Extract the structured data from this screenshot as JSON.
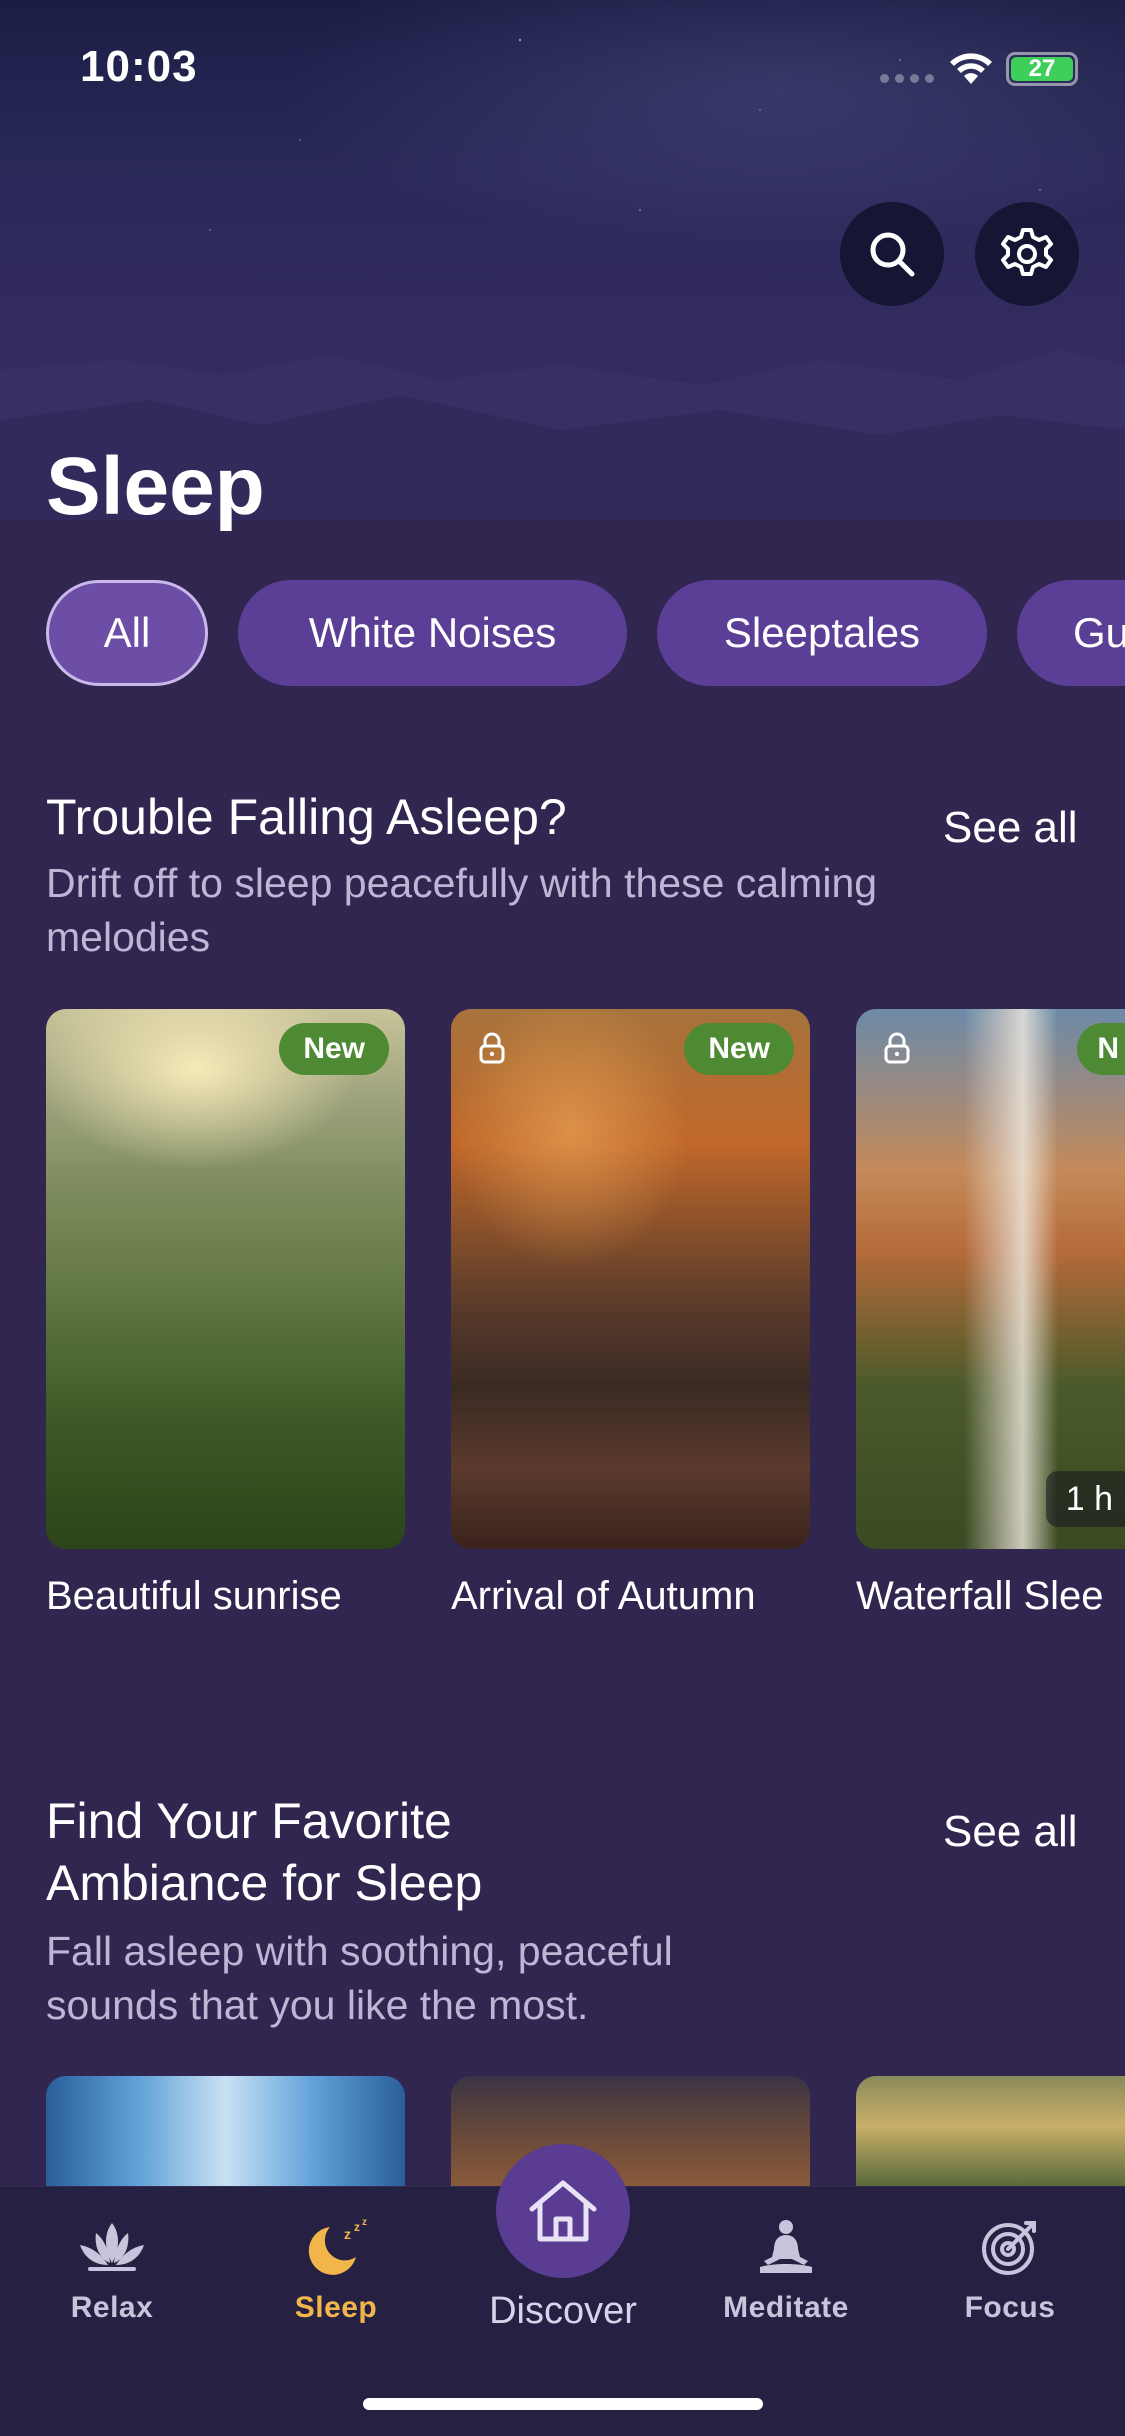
{
  "status_bar": {
    "time": "10:03",
    "battery": "27"
  },
  "page": {
    "title": "Sleep"
  },
  "filters": [
    "All",
    "White Noises",
    "Sleeptales",
    "Gu"
  ],
  "section1": {
    "title": "Trouble Falling Asleep?",
    "subtitle": "Drift off to sleep peacefully with these calming melodies",
    "see_all": "See all",
    "cards": [
      {
        "label": "Beautiful sunrise",
        "badge": "New",
        "locked": false
      },
      {
        "label": "Arrival of Autumn",
        "badge": "New",
        "locked": true
      },
      {
        "label": "Waterfall Slee",
        "badge": "N",
        "locked": true,
        "duration": "1 h"
      }
    ]
  },
  "section2": {
    "title_line1": "Find Your Favorite",
    "title_line2": "Ambiance for Sleep",
    "subtitle": "Fall asleep with soothing, peaceful sounds that you like the most.",
    "see_all": "See all"
  },
  "tabs": [
    {
      "label": "Relax",
      "icon": "lotus-icon"
    },
    {
      "label": "Sleep",
      "icon": "moon-icon",
      "active": true
    },
    {
      "label": "Discover",
      "icon": "home-icon"
    },
    {
      "label": "Meditate",
      "icon": "meditate-icon"
    },
    {
      "label": "Focus",
      "icon": "target-icon"
    }
  ],
  "colors": {
    "background": "#302650",
    "accent": "#f2b54a",
    "chip": "#5b3f97",
    "badge": "#4e8a33"
  }
}
